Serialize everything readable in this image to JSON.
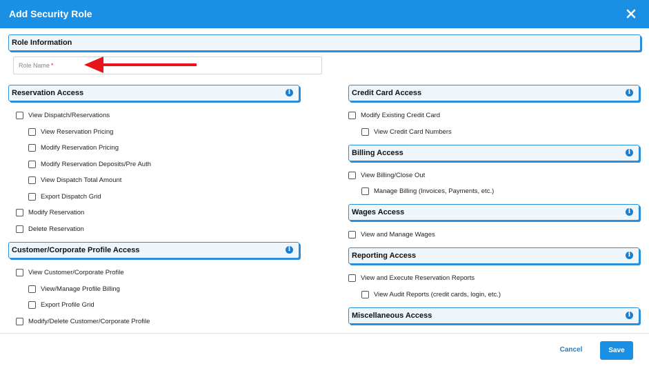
{
  "dialog": {
    "title": "Add Security Role"
  },
  "role_info": {
    "header": "Role Information",
    "role_name_placeholder": "Role Name",
    "required_mark": "*"
  },
  "sections": {
    "reservation": {
      "header": "Reservation Access",
      "items": [
        "View Dispatch/Reservations",
        "View Reservation Pricing",
        "Modify Reservation Pricing",
        "Modify Reservation Deposits/Pre Auth",
        "View Dispatch Total Amount",
        "Export Dispatch Grid",
        "Modify Reservation",
        "Delete Reservation"
      ]
    },
    "customer": {
      "header": "Customer/Corporate Profile Access",
      "items": [
        "View Customer/Corporate Profile",
        "View/Manage Profile Billing",
        "Export Profile Grid",
        "Modify/Delete Customer/Corporate Profile"
      ]
    },
    "credit_card": {
      "header": "Credit Card Access",
      "items": [
        "Modify Existing Credit Card",
        "View Credit Card Numbers"
      ]
    },
    "billing": {
      "header": "Billing Access",
      "items": [
        "View Billing/Close Out",
        "Manage Billing (Invoices, Payments, etc.)"
      ]
    },
    "wages": {
      "header": "Wages Access",
      "items": [
        "View and Manage Wages"
      ]
    },
    "reporting": {
      "header": "Reporting Access",
      "items": [
        "View and Execute Reservation Reports",
        "View Audit Reports (credit cards, login, etc.)"
      ]
    },
    "misc": {
      "header": "Miscellaneous Access"
    }
  },
  "info_glyph": "i",
  "footer": {
    "cancel_label": "Cancel",
    "save_label": "Save"
  },
  "colors": {
    "primary": "#1b8fe3",
    "header_bg": "#eef6fc",
    "header_border": "#2a8fd8",
    "arrow": "#e8141b",
    "required": "#e0202a"
  },
  "icons": {
    "close": "close-icon",
    "info": "info-icon",
    "annotation": "red-arrow-annotation"
  }
}
